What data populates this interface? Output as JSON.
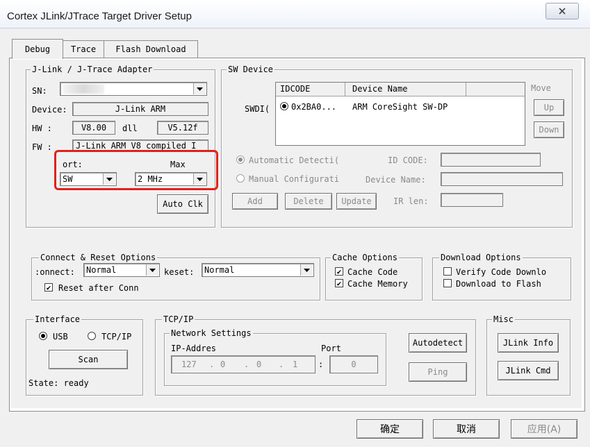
{
  "window": {
    "title": "Cortex JLink/JTrace Target Driver Setup"
  },
  "tabs": [
    "Debug",
    "Trace",
    "Flash Download"
  ],
  "adapter": {
    "group_label": "J-Link / J-Trace Adapter",
    "sn_label": "SN:",
    "device_label": "Device:",
    "device_value": "J-Link ARM",
    "hw_label": "HW :",
    "hw_value": "V8.00",
    "dll_label": "dll",
    "dll_value": "V5.12f",
    "fw_label": "FW :",
    "fw_value": "J-Link ARM V8 compiled I",
    "port_label": "ort:",
    "port_value": "SW",
    "max_label": "Max",
    "max_value": "2 MHz",
    "auto_clk": "Auto Clk",
    "highlight_color": "#e0211b"
  },
  "sw_device": {
    "group_label": "SW Device",
    "swdi_label": "SWDI(",
    "columns": [
      "IDCODE",
      "Device Name"
    ],
    "rows": [
      {
        "idcode": "0x2BA0...",
        "name": "ARM CoreSight SW-DP"
      }
    ],
    "move_label": "Move",
    "up": "Up",
    "down": "Down",
    "auto_detect": "Automatic Detecti(",
    "manual_config": "Manual Configurati",
    "id_code_label": "ID CODE:",
    "device_name_label": "Device Name:",
    "add": "Add",
    "delete": "Delete",
    "update": "Update",
    "ir_len_label": "IR len:"
  },
  "connect_reset": {
    "group_label": "Connect & Reset Options",
    "connect_label": ":onnect:",
    "connect_value": "Normal",
    "reset_label": "keset:",
    "reset_value": "Normal",
    "reset_after_conn": "Reset after Conn"
  },
  "cache": {
    "group_label": "Cache Options",
    "cache_code": "Cache Code",
    "cache_memory": "Cache Memory"
  },
  "download": {
    "group_label": "Download Options",
    "verify": "Verify Code Downlo",
    "download_flash": "Download to Flash"
  },
  "interface": {
    "group_label": "Interface",
    "usb": "USB",
    "tcpip": "TCP/IP",
    "scan": "Scan",
    "state": "State: ready"
  },
  "tcpip": {
    "group_label": "TCP/IP",
    "network_label": "Network Settings",
    "ip_label": "IP-Addres",
    "port_label": "Port",
    "ip": [
      "127",
      "0",
      "0",
      "1"
    ],
    "port_value": "0",
    "autodetect": "Autodetect",
    "ping": "Ping"
  },
  "misc": {
    "group_label": "Misc",
    "jlink_info": "JLink Info",
    "jlink_cmd": "JLink Cmd"
  },
  "footer": {
    "ok": "确定",
    "cancel": "取消",
    "apply": "应用(A)"
  }
}
